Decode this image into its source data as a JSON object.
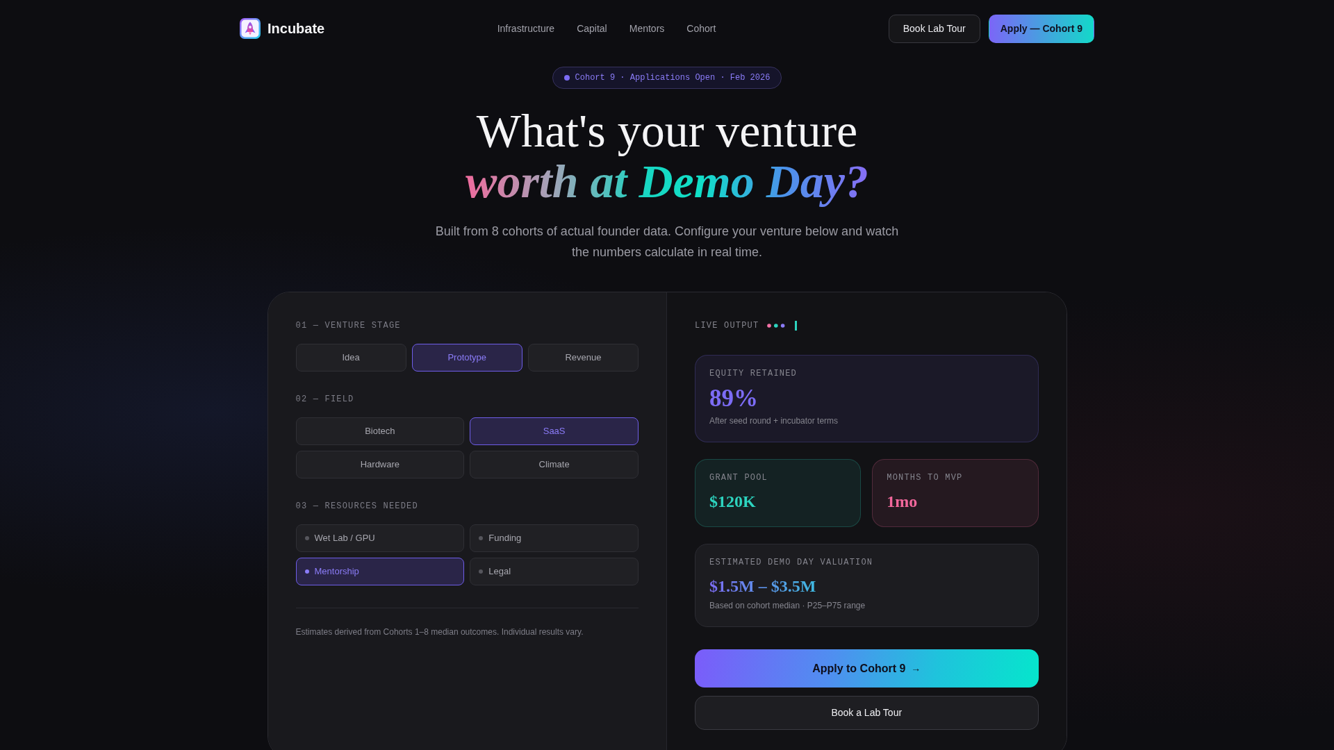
{
  "header": {
    "brand": "Incubate",
    "nav_links": [
      {
        "label": "Infrastructure"
      },
      {
        "label": "Capital"
      },
      {
        "label": "Mentors"
      },
      {
        "label": "Cohort"
      }
    ],
    "actions": [
      {
        "kind": "secondary",
        "label": "Book Lab Tour"
      },
      {
        "kind": "primary",
        "label": "Apply — Cohort 9"
      }
    ]
  },
  "hero": {
    "badge": "Cohort 9 · Applications Open · Feb 2026",
    "title": "What's your venture",
    "title_highlight": "worth at Demo Day?",
    "subtitle": "Built from 8 cohorts of actual founder data. Configure your venture below and watch the numbers calculate in real time."
  },
  "configurator": {
    "sections": [
      {
        "kind": "segmented",
        "label": "01 — VENTURE STAGE",
        "options": [
          {
            "label": "Idea",
            "selected": false
          },
          {
            "label": "Prototype",
            "selected": true
          },
          {
            "label": "Revenue",
            "selected": false
          }
        ]
      },
      {
        "kind": "grid",
        "label": "02 — FIELD",
        "options": [
          {
            "label": "Biotech",
            "selected": false
          },
          {
            "label": "SaaS",
            "selected": true
          },
          {
            "label": "Hardware",
            "selected": false
          },
          {
            "label": "Climate",
            "selected": false
          }
        ]
      },
      {
        "kind": "checklist",
        "label": "03 — RESOURCES NEEDED",
        "options": [
          {
            "label": "Wet Lab / GPU",
            "selected": false
          },
          {
            "label": "Funding",
            "selected": false
          },
          {
            "label": "Mentorship",
            "selected": true
          },
          {
            "label": "Legal",
            "selected": false
          }
        ]
      }
    ],
    "note": "Estimates derived from Cohorts 1–8 median outcomes. Individual results vary."
  },
  "output": {
    "label": "LIVE OUTPUT",
    "metrics": [
      {
        "kind": "wide",
        "label": "EQUITY RETAINED",
        "value": "89%",
        "note": "After seed round + incubator terms",
        "color": "#7c6cf5"
      },
      {
        "kind": "half",
        "label": "GRANT POOL",
        "value": "$120K",
        "color": "#2dd4bf"
      },
      {
        "kind": "half",
        "label": "MONTHS TO MVP",
        "value": "1mo",
        "color": "#f2689c"
      },
      {
        "kind": "range",
        "label": "ESTIMATED DEMO DAY VALUATION",
        "value": "$1.5M – $3.5M",
        "note": "Based on cohort median · P25–P75 range"
      }
    ],
    "actions": [
      {
        "kind": "primary",
        "label": "Apply to Cohort 9",
        "arrow": "→"
      },
      {
        "kind": "secondary",
        "label": "Book a Lab Tour"
      }
    ]
  }
}
